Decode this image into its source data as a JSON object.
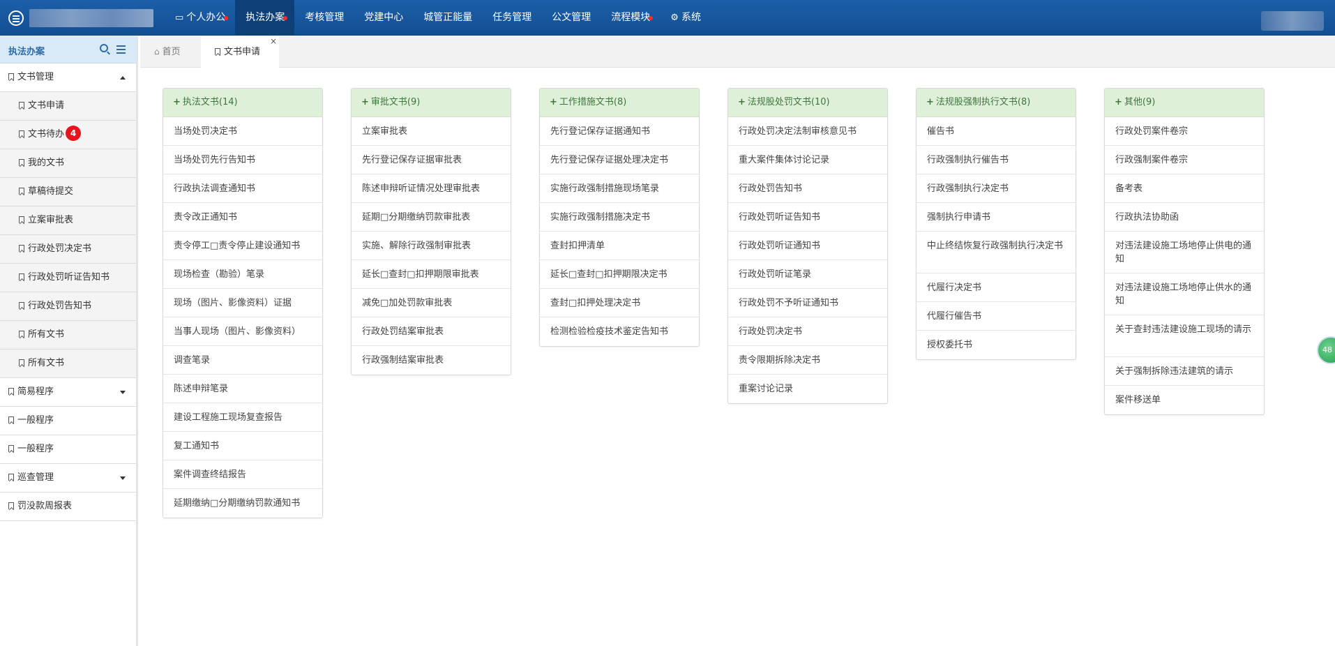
{
  "nav": {
    "items": [
      {
        "label": "个人办公",
        "icon": "monitor-icon",
        "dot": true,
        "active": false
      },
      {
        "label": "执法办案",
        "icon": "",
        "dot": true,
        "active": true
      },
      {
        "label": "考核管理",
        "icon": "",
        "dot": false,
        "active": false
      },
      {
        "label": "党建中心",
        "icon": "",
        "dot": false,
        "active": false
      },
      {
        "label": "城管正能量",
        "icon": "",
        "dot": false,
        "active": false
      },
      {
        "label": "任务管理",
        "icon": "",
        "dot": false,
        "active": false
      },
      {
        "label": "公文管理",
        "icon": "",
        "dot": false,
        "active": false
      },
      {
        "label": "流程模块",
        "icon": "",
        "dot": true,
        "active": false
      },
      {
        "label": "系统",
        "icon": "gear-icon",
        "dot": false,
        "active": false
      }
    ]
  },
  "sidebar": {
    "title": "执法办案",
    "items": [
      {
        "label": "文书管理",
        "type": "group",
        "caret": "up"
      },
      {
        "label": "文书申请",
        "type": "sub"
      },
      {
        "label": "文书待办",
        "type": "sub",
        "badge": "4"
      },
      {
        "label": "我的文书",
        "type": "sub"
      },
      {
        "label": "草稿待提交",
        "type": "sub"
      },
      {
        "label": "立案审批表",
        "type": "sub"
      },
      {
        "label": "行政处罚决定书",
        "type": "sub"
      },
      {
        "label": "行政处罚听证告知书",
        "type": "sub"
      },
      {
        "label": "行政处罚告知书",
        "type": "sub"
      },
      {
        "label": "所有文书",
        "type": "sub"
      },
      {
        "label": "所有文书",
        "type": "sub"
      },
      {
        "label": "简易程序",
        "type": "group",
        "caret": "down"
      },
      {
        "label": "一般程序",
        "type": "group"
      },
      {
        "label": "一般程序",
        "type": "group"
      },
      {
        "label": "巡查管理",
        "type": "group",
        "caret": "down"
      },
      {
        "label": "罚没款周报表",
        "type": "group"
      }
    ]
  },
  "tabs": {
    "home": "首页",
    "active": "文书申请",
    "close": "×"
  },
  "cards": [
    {
      "title": "执法文书(14)",
      "items": [
        "当场处罚决定书",
        "当场处罚先行告知书",
        "行政执法调查通知书",
        "责令改正通知书",
        "责令停工□责令停止建设通知书",
        "现场检查（勘验）笔录",
        "现场（图片、影像资料）证据",
        "当事人现场（图片、影像资料）",
        "调查笔录",
        "陈述申辩笔录",
        "建设工程施工现场复查报告",
        "复工通知书",
        "案件调查终结报告",
        "延期缴纳□分期缴纳罚款通知书"
      ]
    },
    {
      "title": "审批文书(9)",
      "items": [
        "立案审批表",
        "先行登记保存证据审批表",
        "陈述申辩听证情况处理审批表",
        "延期□分期缴纳罚款审批表",
        "实施、解除行政强制审批表",
        "延长□查封□扣押期限审批表",
        "减免□加处罚款审批表",
        "行政处罚结案审批表",
        "行政强制结案审批表"
      ]
    },
    {
      "title": "工作措施文书(8)",
      "items": [
        "先行登记保存证据通知书",
        "先行登记保存证据处理决定书",
        "实施行政强制措施现场笔录",
        "实施行政强制措施决定书",
        "查封扣押清单",
        "延长□查封□扣押期限决定书",
        "查封□扣押处理决定书",
        "检测检验检疫技术鉴定告知书"
      ]
    },
    {
      "title": "法规股处罚文书(10)",
      "items": [
        "行政处罚决定法制审核意见书",
        "重大案件集体讨论记录",
        "行政处罚告知书",
        "行政处罚听证告知书",
        "行政处罚听证通知书",
        "行政处罚听证笔录",
        "行政处罚不予听证通知书",
        "行政处罚决定书",
        "责令限期拆除决定书",
        "重案讨论记录"
      ]
    },
    {
      "title": "法规股强制执行文书(8)",
      "items": [
        "催告书",
        "行政强制执行催告书",
        "行政强制执行决定书",
        "强制执行申请书",
        "中止终结恢复行政强制执行决定书",
        "代履行决定书",
        "代履行催告书",
        "授权委托书"
      ]
    },
    {
      "title": "其他(9)",
      "items": [
        "行政处罚案件卷宗",
        "行政强制案件卷宗",
        "备考表",
        "行政执法协助函",
        "对违法建设施工场地停止供电的通知",
        "对违法建设施工场地停止供水的通知",
        "关于查封违法建设施工现场的请示",
        "关于强制拆除违法建筑的请示",
        "案件移送单"
      ]
    }
  ],
  "float_badge": "48"
}
